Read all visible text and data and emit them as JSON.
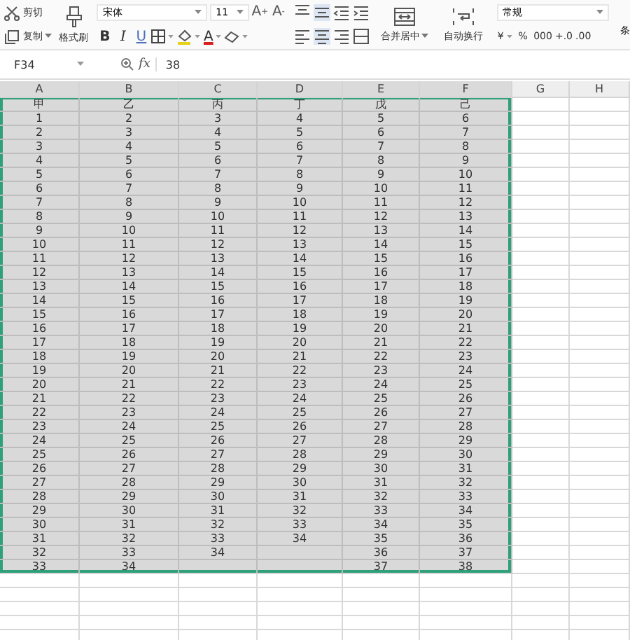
{
  "toolbar": {
    "clipboard": [
      {
        "kind": "cut",
        "label": "剪切",
        "dropdown": false
      },
      {
        "kind": "copy",
        "label": "复制",
        "dropdown": true
      }
    ],
    "format_painter": {
      "label": "格式刷"
    },
    "font": {
      "name": "宋体",
      "size": "11",
      "grow": {
        "label": "A",
        "sign": "+"
      },
      "shrink": {
        "label": "A",
        "sign": "-"
      }
    },
    "styles": [
      {
        "kind": "bold",
        "label": "B",
        "dropdown": false
      },
      {
        "kind": "italic",
        "label": "I",
        "dropdown": false
      },
      {
        "kind": "underline",
        "label": "U",
        "dropdown": false
      },
      {
        "kind": "border",
        "dropdown": true
      },
      {
        "kind": "fill",
        "dropdown": true
      },
      {
        "kind": "color",
        "label": "A",
        "dropdown": true
      },
      {
        "kind": "eraser",
        "dropdown": true
      }
    ],
    "align_top": [
      {
        "kind": "align-top",
        "selected": false
      },
      {
        "kind": "align-middle",
        "selected": true
      },
      {
        "kind": "indent-less",
        "selected": false
      },
      {
        "kind": "indent-more",
        "selected": false
      }
    ],
    "align_bottom": [
      {
        "kind": "align-left",
        "selected": false
      },
      {
        "kind": "align-center",
        "selected": true
      },
      {
        "kind": "align-right",
        "selected": false
      },
      {
        "kind": "distribute",
        "selected": false
      }
    ],
    "merge": {
      "label": "合并居中",
      "dropdown": true
    },
    "wrap": {
      "label": "自动换行"
    },
    "number_format": "常规",
    "number_buttons": [
      {
        "label": "¥",
        "dropdown": true
      },
      {
        "label": "%",
        "dropdown": false
      },
      {
        "label": "000",
        "dropdown": false
      },
      {
        "label": "+.0",
        "dropdown": false
      },
      {
        "label": ".00",
        "dropdown": false
      }
    ],
    "overflow_label": "条"
  },
  "formula_bar": {
    "name_box": "F34",
    "fx": "fx",
    "value": "38"
  },
  "sheet": {
    "columns": [
      {
        "label": "A",
        "selected": true
      },
      {
        "label": "B",
        "selected": true
      },
      {
        "label": "C",
        "selected": true
      },
      {
        "label": "D",
        "selected": true
      },
      {
        "label": "E",
        "selected": true
      },
      {
        "label": "F",
        "selected": true
      },
      {
        "label": "G",
        "selected": false
      },
      {
        "label": "H",
        "selected": false
      }
    ],
    "rows": [
      [
        "甲",
        "乙",
        "丙",
        "丁",
        "戊",
        "己"
      ],
      [
        "1",
        "2",
        "3",
        "4",
        "5",
        "6"
      ],
      [
        "2",
        "3",
        "4",
        "5",
        "6",
        "7"
      ],
      [
        "3",
        "4",
        "5",
        "6",
        "7",
        "8"
      ],
      [
        "4",
        "5",
        "6",
        "7",
        "8",
        "9"
      ],
      [
        "5",
        "6",
        "7",
        "8",
        "9",
        "10"
      ],
      [
        "6",
        "7",
        "8",
        "9",
        "10",
        "11"
      ],
      [
        "7",
        "8",
        "9",
        "10",
        "11",
        "12"
      ],
      [
        "8",
        "9",
        "10",
        "11",
        "12",
        "13"
      ],
      [
        "9",
        "10",
        "11",
        "12",
        "13",
        "14"
      ],
      [
        "10",
        "11",
        "12",
        "13",
        "14",
        "15"
      ],
      [
        "11",
        "12",
        "13",
        "14",
        "15",
        "16"
      ],
      [
        "12",
        "13",
        "14",
        "15",
        "16",
        "17"
      ],
      [
        "13",
        "14",
        "15",
        "16",
        "17",
        "18"
      ],
      [
        "14",
        "15",
        "16",
        "17",
        "18",
        "19"
      ],
      [
        "15",
        "16",
        "17",
        "18",
        "19",
        "20"
      ],
      [
        "16",
        "17",
        "18",
        "19",
        "20",
        "21"
      ],
      [
        "17",
        "18",
        "19",
        "20",
        "21",
        "22"
      ],
      [
        "18",
        "19",
        "20",
        "21",
        "22",
        "23"
      ],
      [
        "19",
        "20",
        "21",
        "22",
        "23",
        "24"
      ],
      [
        "20",
        "21",
        "22",
        "23",
        "24",
        "25"
      ],
      [
        "21",
        "22",
        "23",
        "24",
        "25",
        "26"
      ],
      [
        "22",
        "23",
        "24",
        "25",
        "26",
        "27"
      ],
      [
        "23",
        "24",
        "25",
        "26",
        "27",
        "28"
      ],
      [
        "24",
        "25",
        "26",
        "27",
        "28",
        "29"
      ],
      [
        "25",
        "26",
        "27",
        "28",
        "29",
        "30"
      ],
      [
        "26",
        "27",
        "28",
        "29",
        "30",
        "31"
      ],
      [
        "27",
        "28",
        "29",
        "30",
        "31",
        "32"
      ],
      [
        "28",
        "29",
        "30",
        "31",
        "32",
        "33"
      ],
      [
        "29",
        "30",
        "31",
        "32",
        "33",
        "34"
      ],
      [
        "30",
        "31",
        "32",
        "33",
        "34",
        "35"
      ],
      [
        "31",
        "32",
        "33",
        "34",
        "35",
        "36"
      ],
      [
        "32",
        "33",
        "34",
        null,
        "36",
        "37"
      ],
      [
        "33",
        "34",
        null,
        null,
        "37",
        "38"
      ]
    ]
  }
}
